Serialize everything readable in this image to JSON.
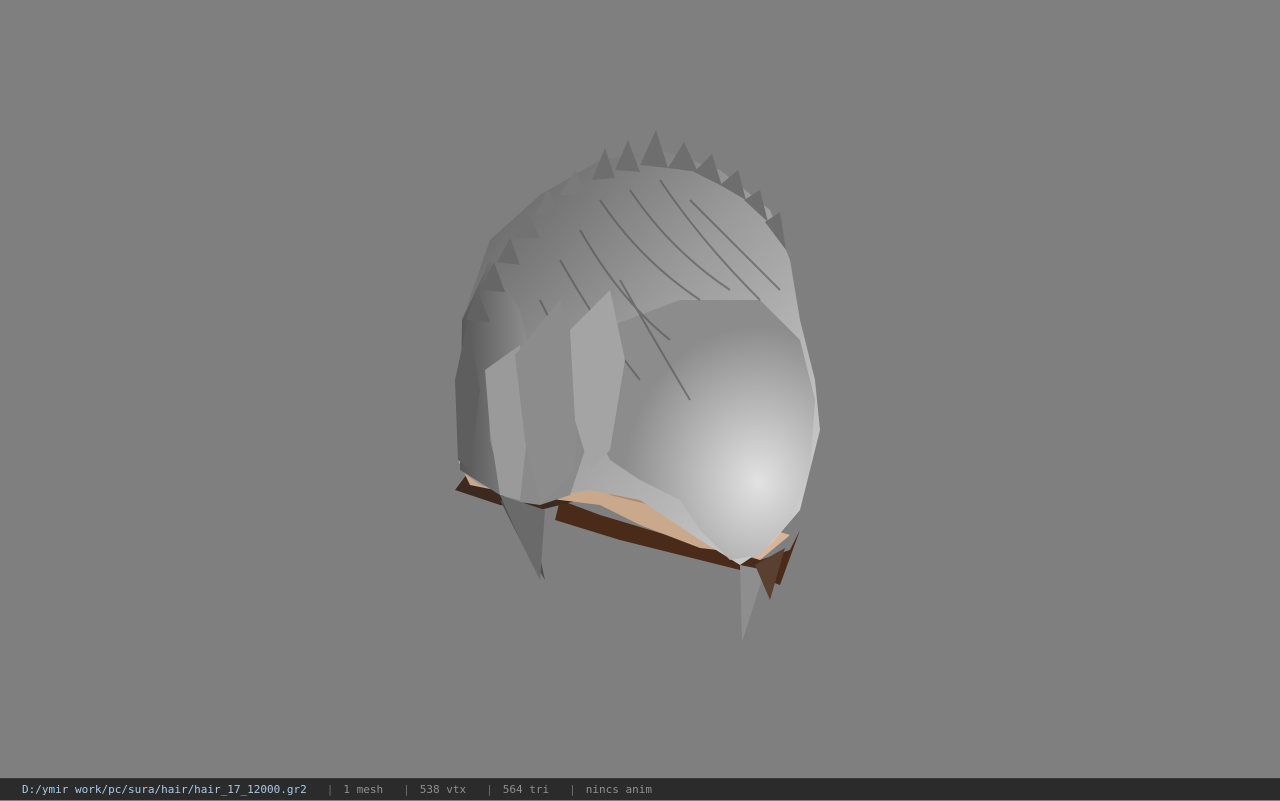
{
  "viewer": {
    "background_color": "#7f7f7f",
    "model_icon": "hair-mesh-model"
  },
  "statusbar": {
    "file_path": "D:/ymir work/pc/sura/hair/hair_17_12000.gr2",
    "separator": "|",
    "mesh_count": "1 mesh",
    "vertex_count": "538 vtx",
    "triangle_count": "564 tri",
    "anim_label": "nincs anim",
    "path_color": "#a8c8e8",
    "bar_color": "#2b2b2b"
  }
}
